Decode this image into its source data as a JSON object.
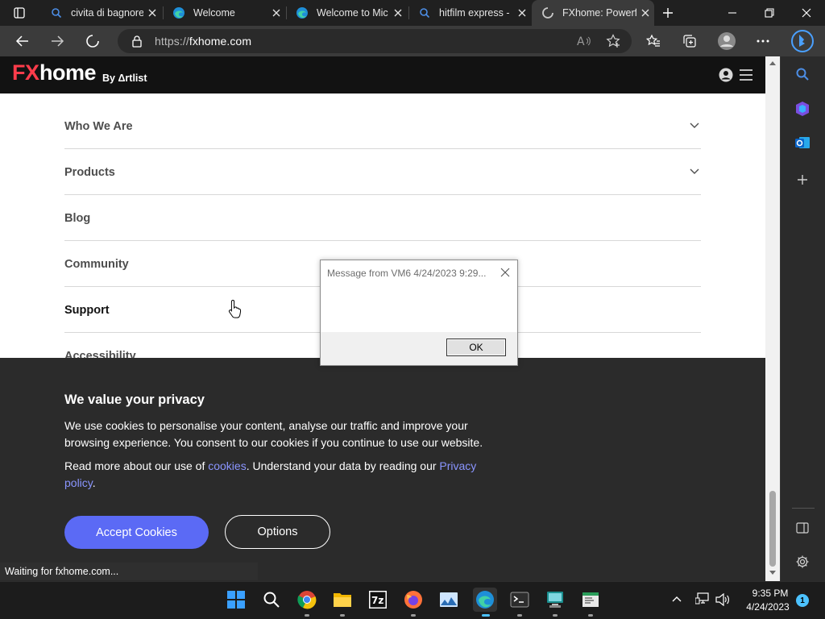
{
  "browser": {
    "tabs": [
      {
        "title": "civita di bagnore",
        "icon": "search-icon"
      },
      {
        "title": "Welcome",
        "icon": "edge-icon"
      },
      {
        "title": "Welcome to Mic",
        "icon": "edge-icon"
      },
      {
        "title": "hitfilm express -",
        "icon": "search-icon"
      },
      {
        "title": "FXhome: Powerf",
        "icon": "loading-spinner-icon"
      }
    ],
    "url_scheme": "https://",
    "url_host": "fxhome.com",
    "status_text": "Waiting for fxhome.com..."
  },
  "site": {
    "logo_fx": "FX",
    "logo_home": "home",
    "logo_by": "By Δrtlist",
    "menu": [
      {
        "label": "Who We Are",
        "expandable": true
      },
      {
        "label": "Products",
        "expandable": true
      },
      {
        "label": "Blog",
        "expandable": false
      },
      {
        "label": "Community",
        "expandable": false
      },
      {
        "label": "Support",
        "expandable": false
      },
      {
        "label": "Accessibility",
        "expandable": false
      }
    ]
  },
  "cookie_banner": {
    "title": "We value your privacy",
    "paragraph1": "We use cookies to personalise your content, analyse our traffic and improve your browsing experience. You consent to our cookies if you continue to use our website.",
    "p2_prefix": "Read more about our use of ",
    "p2_link1": "cookies",
    "p2_middle": ". Understand your data by reading our ",
    "p2_link2": "Privacy policy",
    "p2_suffix": ".",
    "accept_label": "Accept Cookies",
    "options_label": "Options"
  },
  "message_box": {
    "title": "Message from VM6 4/24/2023 9:29...",
    "body": "",
    "ok_label": "OK"
  },
  "taskbar": {
    "time": "9:35 PM",
    "date": "4/24/2023",
    "notification_count": "1"
  }
}
